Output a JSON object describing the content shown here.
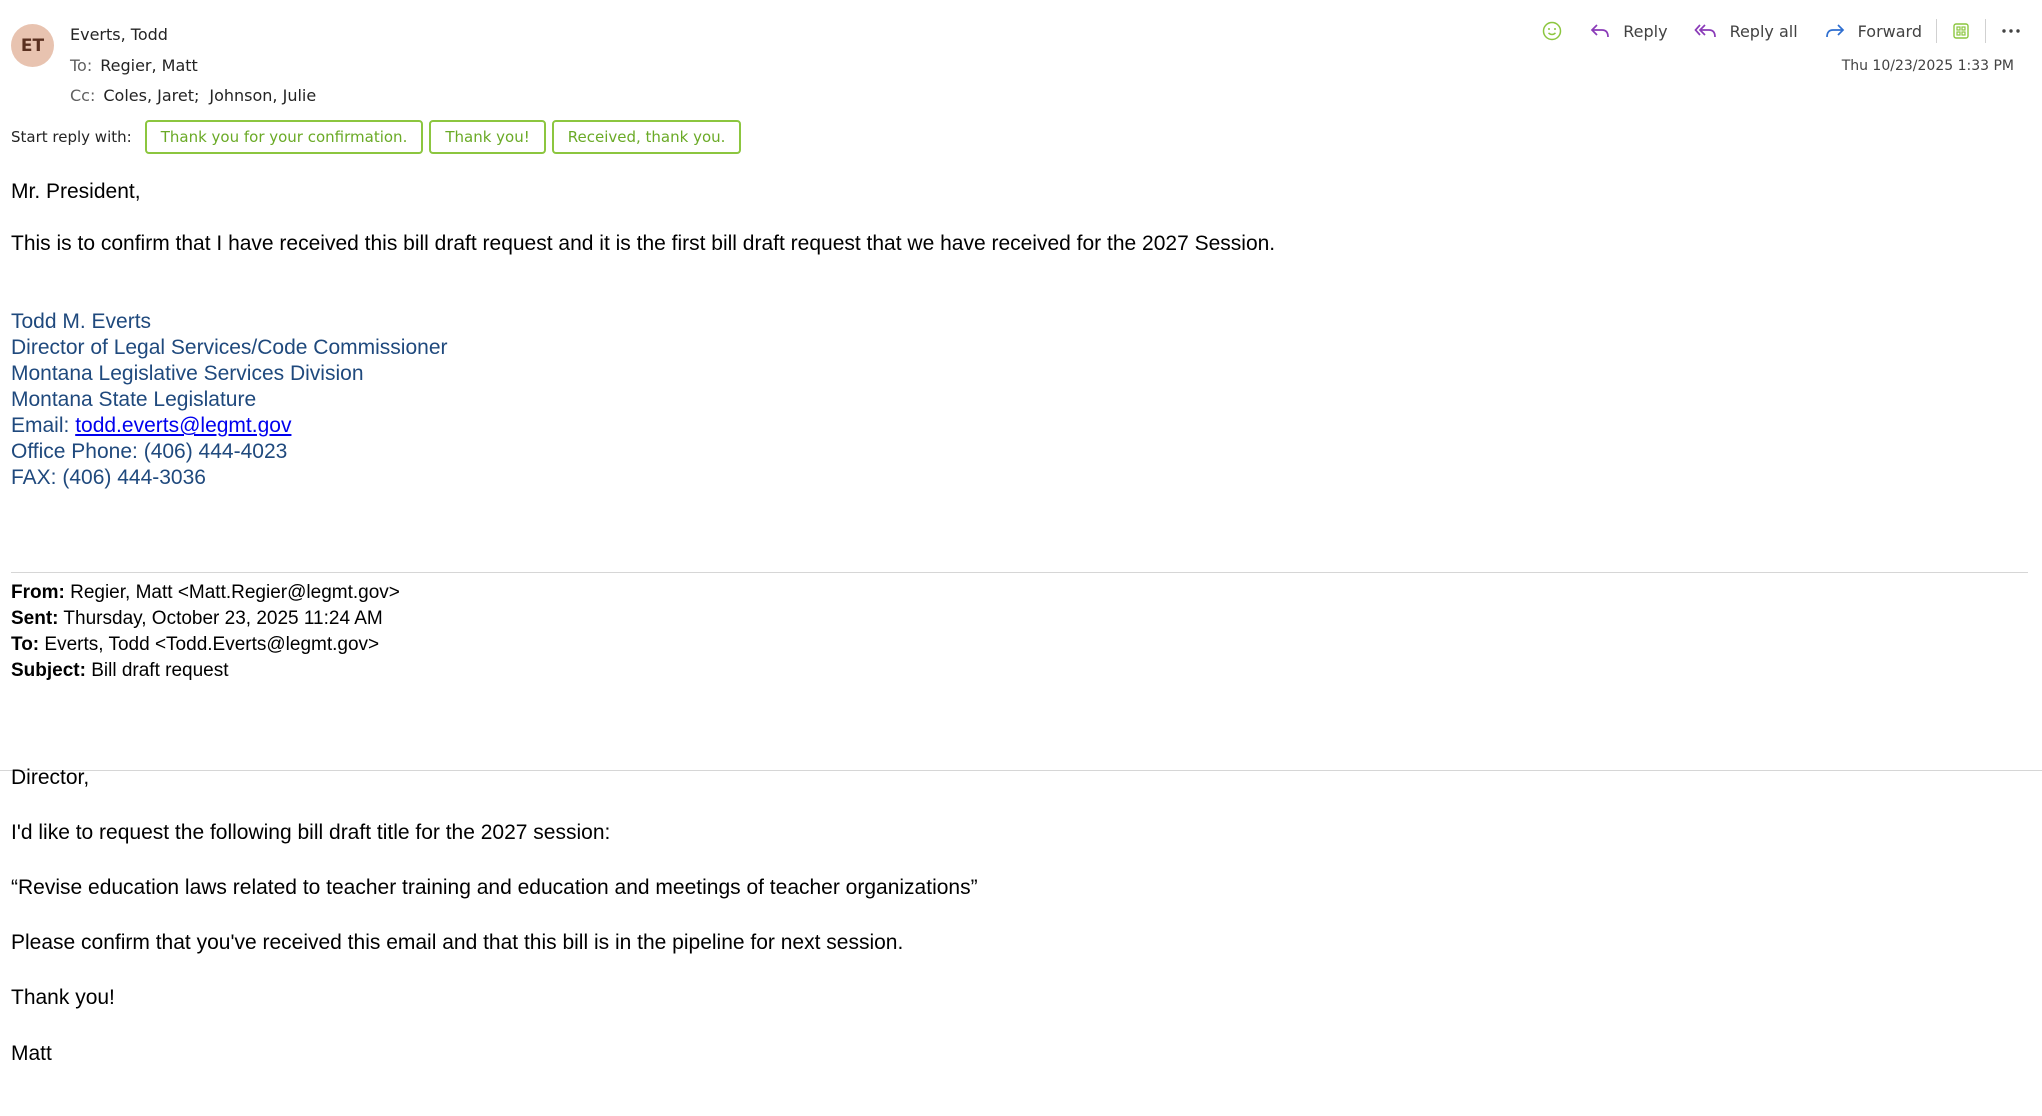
{
  "header": {
    "avatar_initials": "ET",
    "sender": "Everts, Todd",
    "to_label": "To:",
    "to": "Regier, Matt",
    "cc_label": "Cc:",
    "cc": [
      "Coles, Jaret;",
      "Johnson, Julie"
    ],
    "date": "Thu 10/23/2025 1:33 PM"
  },
  "toolbar": {
    "reply": "Reply",
    "reply_all": "Reply all",
    "forward": "Forward",
    "icons": [
      "emoji-icon",
      "reply-icon",
      "reply-all-icon",
      "forward-icon",
      "apps-icon",
      "more-icon"
    ]
  },
  "suggested": {
    "label": "Start reply with:",
    "options": [
      "Thank you for your confirmation.",
      "Thank you!",
      "Received, thank you."
    ]
  },
  "message": {
    "greeting": "Mr. President,",
    "body": "This is to confirm that I have received this bill draft request and it is the first bill draft request that we have received for the 2027 Session."
  },
  "signature": {
    "name": "Todd M. Everts",
    "title": "Director of Legal Services/Code Commissioner",
    "division": "Montana Legislative Services Division",
    "org": "Montana State Legislature",
    "email_label": "Email: ",
    "email": "todd.everts@legmt.gov",
    "phone": "Office Phone: (406) 444-4023",
    "fax": "FAX: (406) 444-3036"
  },
  "original": {
    "from_label": "From:",
    "from": " Regier, Matt <Matt.Regier@legmt.gov>",
    "sent_label": "Sent:",
    "sent": " Thursday, October 23, 2025 11:24 AM",
    "to_label": "To:",
    "to": " Everts, Todd <Todd.Everts@legmt.gov>",
    "subject_label": "Subject:",
    "subject": " Bill draft request",
    "lines": [
      "Director,",
      "I'd like to request the following bill draft title for the 2027 session:",
      "“Revise education laws related to teacher training and education and meetings of teacher organizations”",
      "Please confirm that you've received this email and that this bill is in the pipeline for next session.",
      "Thank you!",
      "Matt"
    ]
  },
  "colors": {
    "accent_purple": "#8a3ab8",
    "forward_blue": "#2f6fd0",
    "suggest_green": "#8cc63f",
    "signature_blue": "#1f497d"
  }
}
